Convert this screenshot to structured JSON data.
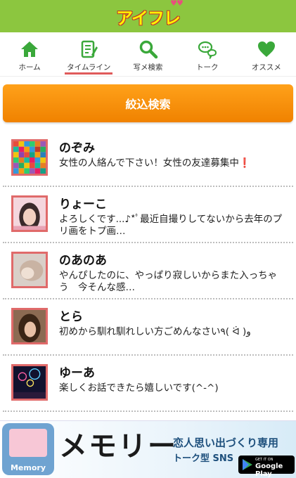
{
  "header": {
    "logo_text": "アイフレ"
  },
  "nav": {
    "items": [
      {
        "label": "ホーム",
        "icon": "home-icon"
      },
      {
        "label": "タイムライン",
        "icon": "timeline-icon",
        "active": true
      },
      {
        "label": "写メ検索",
        "icon": "search-icon"
      },
      {
        "label": "トーク",
        "icon": "chat-icon"
      },
      {
        "label": "オススメ",
        "icon": "heart-icon"
      }
    ]
  },
  "search_button": {
    "label": "絞込検索"
  },
  "timeline": [
    {
      "name": "のぞみ",
      "message": "女性の人絡んで下さい！女性の友達募集中",
      "mark": "❗"
    },
    {
      "name": "りょーこ",
      "message": "よろしくです...♪*ﾟ最近自撮りしてないから去年のプリ画をトプ画…"
    },
    {
      "name": "のあのあ",
      "message": "やんぴしたのに、やっぱり寂しいからまた入っちゃう　今そんな感…"
    },
    {
      "name": "とら",
      "message": "初めから馴れ馴れしい方ごめんなさい٩( ᐛ )و"
    },
    {
      "name": "ゆーあ",
      "message": "楽しくお話できたら嬉しいです(^-^)"
    }
  ],
  "banner": {
    "app_label": "Memory",
    "title": "メモリー",
    "tagline1": "恋人思い出づくり専用",
    "tagline2": "トーク型 SNS",
    "store_small": "GET IT ON",
    "store_big": "Google Play"
  },
  "colors": {
    "header_bg": "#8cc63f",
    "nav_icon": "#3aa83a",
    "accent_orange": "#f39200",
    "avatar_border": "#e06a6a",
    "active_underline": "#e05a5a"
  }
}
